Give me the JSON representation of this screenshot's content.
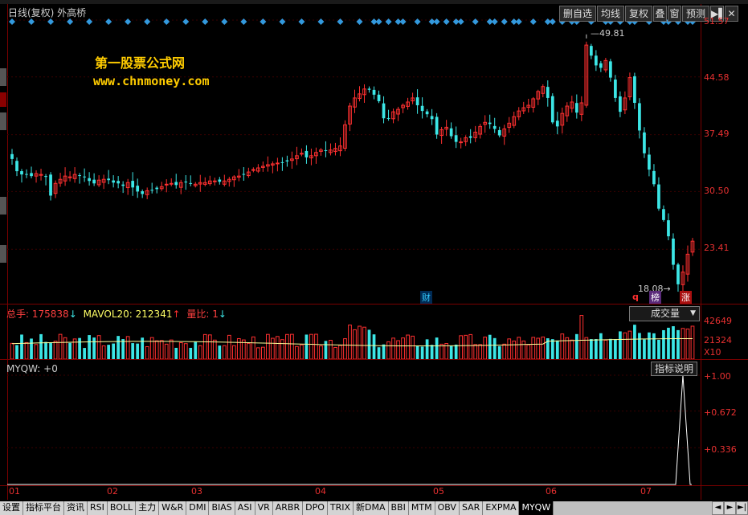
{
  "title": "日线(复权) 外高桥",
  "toolbar": {
    "buttons": [
      "删自选",
      "均线",
      "复权",
      "叠",
      "窗",
      "预测"
    ],
    "icons": [
      "play-pause-icon",
      "close-icon"
    ]
  },
  "watermark": {
    "line1": "第一股票公式网",
    "line2": "www.chnmoney.com"
  },
  "price_axis": [
    "51.57",
    "44.58",
    "37.49",
    "30.50",
    "23.41"
  ],
  "annotations": {
    "high": "49.81",
    "low": "18.08",
    "cai": "财",
    "q": "q",
    "bang": "榜",
    "zhang": "涨"
  },
  "volume_header": {
    "zongshou_label": "总手:",
    "zongshou_value": "175838",
    "mavol_label": "MAVOL20:",
    "mavol_value": "212341",
    "liangbi_label": "量比:",
    "liangbi_value": "1"
  },
  "volume_select": "成交量",
  "volume_axis": [
    "42649",
    "21324",
    "X10"
  ],
  "indicator_header": "MYQW: +0",
  "indicator_button": "指标说明",
  "indicator_axis": [
    "+1.00",
    "+0.672",
    "+0.336"
  ],
  "months": [
    "01",
    "02",
    "03",
    "04",
    "05",
    "06",
    "07"
  ],
  "bottom_tabs": [
    "设置",
    "指标平台",
    "资讯",
    "RSI",
    "BOLL",
    "主力",
    "W&R",
    "DMI",
    "BIAS",
    "ASI",
    "VR",
    "ARBR",
    "DPO",
    "TRIX",
    "新DMA",
    "BBI",
    "MTM",
    "OBV",
    "SAR",
    "EXPMA",
    "MYQW"
  ],
  "active_tab": "MYQW",
  "colors": {
    "up": "#ff3030",
    "down": "#3ce6e6",
    "axis": "#e83030",
    "watermark": "#ffcc00",
    "signal": "#ffffff",
    "diamond": "#3399dd"
  },
  "chart_data": [
    {
      "type": "candlestick",
      "title": "日线(复权) 外高桥",
      "x_months": [
        "01",
        "02",
        "03",
        "04",
        "05",
        "06",
        "07"
      ],
      "ylim": [
        18.0,
        51.57
      ],
      "y_ticks": [
        51.57,
        44.58,
        37.49,
        30.5,
        23.41
      ],
      "key_points": {
        "high": 49.81,
        "low": 18.08
      },
      "close_series": [
        34.5,
        33.0,
        32.6,
        32.6,
        32.4,
        32.7,
        32.6,
        32.3,
        30.0,
        31.5,
        32.0,
        32.4,
        32.3,
        32.6,
        32.5,
        32.3,
        31.8,
        31.5,
        31.9,
        32.0,
        31.9,
        31.6,
        31.5,
        31.2,
        31.6,
        31.0,
        30.5,
        30.2,
        30.6,
        30.7,
        30.8,
        31.1,
        31.4,
        31.5,
        31.3,
        31.6,
        31.7,
        31.5,
        31.4,
        31.6,
        31.6,
        31.8,
        31.8,
        31.7,
        31.8,
        32.0,
        32.3,
        32.4,
        32.6,
        32.9,
        33.2,
        33.4,
        33.6,
        33.8,
        33.9,
        34.0,
        34.1,
        34.2,
        34.5,
        34.9,
        35.2,
        34.7,
        34.9,
        35.3,
        35.6,
        35.5,
        35.6,
        35.8,
        36.1,
        38.7,
        41.0,
        42.0,
        42.5,
        43.1,
        43.0,
        42.4,
        41.6,
        39.5,
        39.5,
        40.3,
        40.6,
        41.1,
        41.5,
        42.0,
        41.1,
        40.4,
        40.0,
        39.4,
        37.5,
        38.1,
        38.4,
        37.3,
        36.6,
        36.6,
        37.1,
        37.1,
        37.8,
        38.5,
        39.0,
        38.8,
        38.2,
        37.4,
        38.2,
        38.9,
        39.7,
        40.4,
        40.8,
        41.1,
        41.9,
        42.8,
        43.4,
        42.0,
        39.0,
        38.5,
        40.1,
        41.0,
        41.5,
        40.2,
        41.4,
        48.5,
        47.2,
        46.0,
        45.7,
        46.6,
        44.5,
        42.0,
        40.3,
        42.0,
        44.5,
        41.4,
        38.0,
        35.2,
        33.2,
        31.4,
        28.4,
        27.0,
        25.0,
        21.5,
        19.1,
        20.6,
        22.8,
        24.4
      ]
    },
    {
      "type": "bar",
      "title": "成交量",
      "y_ticks": [
        42649,
        21324
      ],
      "unit": "X10",
      "legend": {
        "总手": 175838,
        "MAVOL20": 212341,
        "量比": 1
      }
    },
    {
      "type": "line",
      "title": "MYQW",
      "ylim": [
        0,
        1.0
      ],
      "y_ticks": [
        1.0,
        0.672,
        0.336
      ],
      "signal_at_last_bars": 1.0
    }
  ]
}
